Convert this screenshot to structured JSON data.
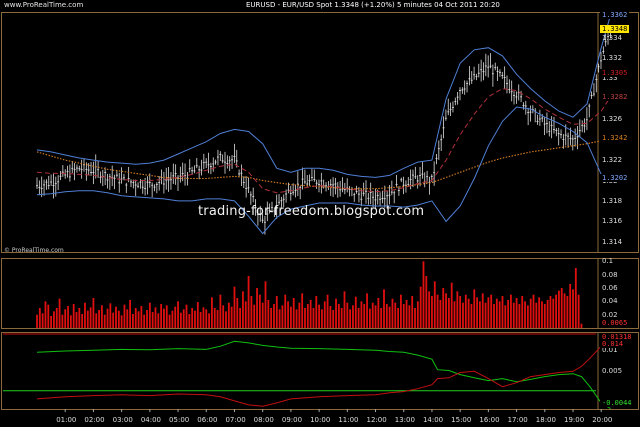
{
  "header": {
    "url": "www.ProRealTime.com",
    "title": "EURUSD - EUR/USD Spot    1.3348 (+1.20%)    5 minutes  04 Oct 2011 20:20"
  },
  "watermark": "trading-for-freedom.blogspot.com",
  "credit": "© ProRealTime.com",
  "colors": {
    "background": "#000000",
    "panel_border": "#8a6a3a",
    "candle": "#e0e0e0",
    "bollinger": "#4f7fd6",
    "bb_mid": "#b0303a",
    "long_ma": "#d98020",
    "volume": "#e01010",
    "di_plus": "#10c010",
    "di_minus": "#c01010",
    "zero_line": "#20d020",
    "price_label": "#ffe600"
  },
  "price_axis": {
    "ticks": [
      "1.334",
      "1.332",
      "1.33",
      "1.328",
      "1.326",
      "1.324",
      "1.322",
      "1.32",
      "1.318",
      "1.316",
      "1.314"
    ],
    "labels": {
      "high": "1.3362",
      "last": "1.3348",
      "band_upper": "1.3305",
      "band_mid": "1.3282",
      "ma_long": "1.3242",
      "band_lower": "1.3202"
    }
  },
  "volume_axis": {
    "ticks": [
      "0.1",
      "0.08",
      "0.06",
      "0.04",
      "0.02"
    ],
    "last_label": "0.0065"
  },
  "osc_axis": {
    "ticks": [
      "0.01",
      "0.005"
    ],
    "labels": {
      "top1": "0.01318",
      "top2": "0.014",
      "bottom": "-0.0044"
    }
  },
  "time_axis": {
    "ticks": [
      "01:00",
      "02:00",
      "03:00",
      "04:00",
      "05:00",
      "06:00",
      "07:00",
      "08:00",
      "09:00",
      "10:00",
      "11:00",
      "12:00",
      "13:00",
      "14:00",
      "15:00",
      "16:00",
      "17:00",
      "18:00",
      "19:00",
      "20:00"
    ]
  },
  "chart_data": [
    {
      "type": "line",
      "panel": "price",
      "ylim": [
        1.313,
        1.3365
      ],
      "x_hours": [
        0,
        0.5,
        1,
        1.5,
        2,
        2.5,
        3,
        3.5,
        4,
        4.5,
        5,
        5.5,
        6,
        6.5,
        7,
        7.5,
        8,
        8.5,
        9,
        9.5,
        10,
        10.5,
        11,
        11.5,
        12,
        12.5,
        13,
        13.5,
        14,
        14.5,
        15,
        15.5,
        16,
        16.5,
        17,
        17.5,
        18,
        18.5,
        19,
        19.5,
        20,
        20.33
      ],
      "close": [
        1.3195,
        1.3198,
        1.3205,
        1.3212,
        1.321,
        1.3205,
        1.32,
        1.3198,
        1.3196,
        1.32,
        1.3203,
        1.3208,
        1.3215,
        1.3222,
        1.322,
        1.319,
        1.316,
        1.3175,
        1.3192,
        1.3198,
        1.32,
        1.3196,
        1.319,
        1.3186,
        1.3184,
        1.3188,
        1.3198,
        1.3203,
        1.32,
        1.326,
        1.329,
        1.33,
        1.3312,
        1.33,
        1.3285,
        1.3268,
        1.3255,
        1.3245,
        1.324,
        1.326,
        1.332,
        1.3348
      ],
      "bb_upper": [
        1.323,
        1.3228,
        1.3225,
        1.3222,
        1.322,
        1.3218,
        1.3217,
        1.3216,
        1.3217,
        1.322,
        1.3226,
        1.3232,
        1.3238,
        1.3246,
        1.325,
        1.3248,
        1.3236,
        1.3212,
        1.3208,
        1.3212,
        1.3212,
        1.321,
        1.3206,
        1.3204,
        1.3203,
        1.3205,
        1.3212,
        1.3218,
        1.322,
        1.328,
        1.3315,
        1.3328,
        1.333,
        1.3322,
        1.3304,
        1.329,
        1.3278,
        1.3268,
        1.3262,
        1.3275,
        1.333,
        1.3362
      ],
      "bb_mid": [
        1.3208,
        1.3207,
        1.3207,
        1.3206,
        1.3205,
        1.3203,
        1.3201,
        1.32,
        1.32,
        1.3201,
        1.3203,
        1.3206,
        1.321,
        1.3214,
        1.3216,
        1.3208,
        1.3192,
        1.3188,
        1.319,
        1.3193,
        1.3195,
        1.3194,
        1.3192,
        1.319,
        1.3189,
        1.319,
        1.3193,
        1.3197,
        1.32,
        1.322,
        1.3245,
        1.3265,
        1.3282,
        1.329,
        1.3288,
        1.328,
        1.327,
        1.3262,
        1.3255,
        1.3256,
        1.3268,
        1.3282
      ],
      "bb_lower": [
        1.3186,
        1.3187,
        1.3189,
        1.319,
        1.319,
        1.3188,
        1.3185,
        1.3184,
        1.3183,
        1.3182,
        1.318,
        1.318,
        1.3182,
        1.3182,
        1.318,
        1.3165,
        1.3148,
        1.3164,
        1.3172,
        1.3175,
        1.3178,
        1.3178,
        1.3178,
        1.3176,
        1.3175,
        1.3175,
        1.3174,
        1.3176,
        1.318,
        1.316,
        1.3175,
        1.3202,
        1.3234,
        1.3258,
        1.3272,
        1.327,
        1.3262,
        1.3256,
        1.3248,
        1.3237,
        1.3206,
        1.3202
      ],
      "ma_long": [
        1.3228,
        1.3224,
        1.322,
        1.3217,
        1.3214,
        1.3211,
        1.3209,
        1.3207,
        1.3205,
        1.3203,
        1.3202,
        1.3202,
        1.3202,
        1.3203,
        1.3204,
        1.3203,
        1.32,
        1.3198,
        1.3196,
        1.3195,
        1.3194,
        1.3193,
        1.3192,
        1.3192,
        1.3192,
        1.3193,
        1.3194,
        1.3196,
        1.3198,
        1.3203,
        1.3208,
        1.3213,
        1.3218,
        1.3222,
        1.3225,
        1.3228,
        1.323,
        1.3232,
        1.3234,
        1.3236,
        1.3239,
        1.3242
      ]
    },
    {
      "type": "bar",
      "panel": "volume",
      "ylim": [
        0,
        0.105
      ],
      "x_hours_start": 0,
      "x_hours_step": 0.1,
      "values": [
        0.02,
        0.03,
        0.022,
        0.04,
        0.035,
        0.018,
        0.025,
        0.03,
        0.044,
        0.02,
        0.028,
        0.033,
        0.019,
        0.036,
        0.024,
        0.03,
        0.021,
        0.038,
        0.026,
        0.031,
        0.045,
        0.022,
        0.027,
        0.034,
        0.02,
        0.029,
        0.037,
        0.023,
        0.032,
        0.026,
        0.019,
        0.035,
        0.028,
        0.042,
        0.021,
        0.03,
        0.025,
        0.033,
        0.02,
        0.027,
        0.038,
        0.024,
        0.031,
        0.022,
        0.036,
        0.029,
        0.034,
        0.02,
        0.026,
        0.032,
        0.04,
        0.023,
        0.028,
        0.035,
        0.021,
        0.03,
        0.026,
        0.039,
        0.024,
        0.031,
        0.028,
        0.022,
        0.046,
        0.03,
        0.027,
        0.05,
        0.034,
        0.025,
        0.038,
        0.032,
        0.062,
        0.045,
        0.03,
        0.055,
        0.04,
        0.078,
        0.048,
        0.035,
        0.06,
        0.05,
        0.038,
        0.07,
        0.042,
        0.03,
        0.036,
        0.048,
        0.028,
        0.034,
        0.05,
        0.04,
        0.032,
        0.045,
        0.028,
        0.038,
        0.052,
        0.03,
        0.036,
        0.042,
        0.03,
        0.048,
        0.035,
        0.028,
        0.04,
        0.05,
        0.033,
        0.027,
        0.044,
        0.036,
        0.03,
        0.055,
        0.038,
        0.028,
        0.034,
        0.047,
        0.03,
        0.04,
        0.036,
        0.052,
        0.029,
        0.038,
        0.034,
        0.045,
        0.03,
        0.058,
        0.036,
        0.032,
        0.044,
        0.038,
        0.03,
        0.05,
        0.036,
        0.042,
        0.034,
        0.048,
        0.03,
        0.04,
        0.062,
        0.1,
        0.078,
        0.055,
        0.048,
        0.07,
        0.05,
        0.042,
        0.06,
        0.052,
        0.045,
        0.068,
        0.04,
        0.055,
        0.048,
        0.038,
        0.05,
        0.044,
        0.036,
        0.058,
        0.046,
        0.04,
        0.052,
        0.038,
        0.046,
        0.05,
        0.036,
        0.044,
        0.04,
        0.048,
        0.034,
        0.042,
        0.05,
        0.038,
        0.045,
        0.036,
        0.048,
        0.04,
        0.034,
        0.044,
        0.05,
        0.038,
        0.046,
        0.04,
        0.036,
        0.042,
        0.048,
        0.044,
        0.05,
        0.056,
        0.06,
        0.052,
        0.048,
        0.066,
        0.058,
        0.09,
        0.05,
        0.0065
      ],
      "last_value": 0.0065
    },
    {
      "type": "line",
      "panel": "oscillator",
      "ylim": [
        -0.0045,
        0.0145
      ],
      "x_hours": [
        0,
        1,
        2,
        3,
        4,
        5,
        6,
        6.5,
        7,
        7.5,
        8,
        8.5,
        9,
        10,
        11,
        12,
        12.5,
        13,
        13.5,
        14,
        14.2,
        14.6,
        15,
        15.5,
        16,
        16.5,
        17,
        17.5,
        18,
        18.5,
        19,
        19.3,
        19.6,
        20,
        20.33
      ],
      "series": [
        {
          "values": [
            0.0095,
            0.0098,
            0.01,
            0.0102,
            0.0101,
            0.0104,
            0.0102,
            0.011,
            0.0122,
            0.0118,
            0.0112,
            0.0108,
            0.0105,
            0.0104,
            0.0102,
            0.01,
            0.0097,
            0.0095,
            0.0088,
            0.0078,
            0.0052,
            0.005,
            0.004,
            0.0032,
            0.0025,
            0.003,
            0.0022,
            0.0028,
            0.0035,
            0.004,
            0.0042,
            0.0035,
            0.001,
            -0.003,
            -0.0044
          ]
        },
        {
          "values": [
            -0.002,
            -0.0015,
            -0.0012,
            -0.001,
            -0.0012,
            -0.0008,
            -0.001,
            -0.0015,
            -0.0025,
            -0.0035,
            -0.0038,
            -0.003,
            -0.002,
            -0.0015,
            -0.0012,
            -0.001,
            -0.0005,
            -0.0002,
            0.0005,
            0.0015,
            0.003,
            0.0032,
            0.0045,
            0.0048,
            0.003,
            0.001,
            0.002,
            0.0035,
            0.004,
            0.0045,
            0.0048,
            0.006,
            0.008,
            0.011,
            0.0132
          ]
        }
      ],
      "zero_line": 0,
      "top_line": 0.014
    }
  ]
}
